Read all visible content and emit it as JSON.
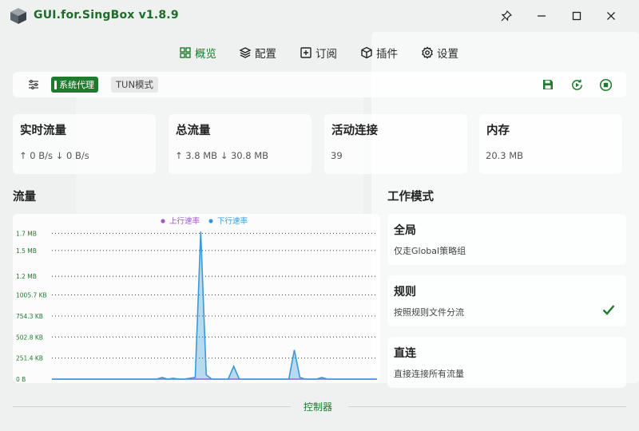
{
  "app": {
    "title": "GUI.for.SingBox v1.8.9"
  },
  "nav": {
    "tabs": [
      {
        "label": "概览",
        "icon": "grid-icon",
        "active": true
      },
      {
        "label": "配置",
        "icon": "layers-icon",
        "active": false
      },
      {
        "label": "订阅",
        "icon": "add-box-icon",
        "active": false
      },
      {
        "label": "插件",
        "icon": "package-icon",
        "active": false
      },
      {
        "label": "设置",
        "icon": "settings-icon",
        "active": false
      }
    ]
  },
  "toolbar": {
    "system_proxy_label": "系统代理",
    "tun_label": "TUN模式",
    "icons": [
      "sliders-icon",
      "save-icon",
      "restart-icon",
      "stop-icon"
    ]
  },
  "stats": [
    {
      "title": "实时流量",
      "value": "↑ 0 B/s ↓ 0 B/s"
    },
    {
      "title": "总流量",
      "value": "↑ 3.8 MB ↓ 30.8 MB"
    },
    {
      "title": "活动连接",
      "value": "39"
    },
    {
      "title": "内存",
      "value": "20.3 MB"
    }
  ],
  "traffic": {
    "section_title": "流量"
  },
  "chart_data": {
    "type": "line",
    "y_ticks": [
      "0 B",
      "251.4 KB",
      "502.8 KB",
      "754.3 KB",
      "1005.7 KB",
      "1.2 MB",
      "1.5 MB",
      "1.7 MB"
    ],
    "ylim": [
      0,
      1.75
    ],
    "yunit": "MB",
    "legend_position": "top",
    "series": [
      {
        "name": "上行速率",
        "color": "#9b59d0",
        "values": [
          0,
          0,
          0,
          0,
          0,
          0,
          0,
          0,
          0,
          0,
          0,
          0,
          0,
          0,
          0,
          0,
          0,
          0,
          0,
          0,
          0,
          0,
          0,
          0,
          0,
          0,
          0,
          0,
          0,
          0,
          0,
          0,
          0,
          0,
          0,
          0,
          0,
          0,
          0,
          0,
          0,
          0,
          0,
          0,
          0,
          0,
          0,
          0,
          0,
          0,
          0,
          0,
          0,
          0,
          0,
          0,
          0,
          0,
          0,
          0
        ]
      },
      {
        "name": "下行速率",
        "color": "#3a9ad9",
        "values": [
          0,
          0,
          0,
          0,
          0,
          0,
          0,
          0,
          0,
          0,
          0,
          0,
          0,
          0,
          0,
          0,
          0,
          0,
          0,
          0,
          0.02,
          0,
          0.01,
          0,
          0,
          0.01,
          0.02,
          1.72,
          0.05,
          0,
          0,
          0,
          0,
          0.15,
          0,
          0,
          0,
          0,
          0,
          0,
          0,
          0,
          0,
          0,
          0.34,
          0.02,
          0,
          0,
          0,
          0.02,
          0,
          0,
          0,
          0,
          0,
          0,
          0,
          0,
          0,
          0
        ]
      }
    ]
  },
  "mode": {
    "section_title": "工作模式",
    "items": [
      {
        "title": "全局",
        "desc": "仅走Global策略组",
        "selected": false
      },
      {
        "title": "规则",
        "desc": "按照规则文件分流",
        "selected": true
      },
      {
        "title": "直连",
        "desc": "直接连接所有流量",
        "selected": false
      }
    ]
  },
  "footer": {
    "label": "控制器"
  },
  "colors": {
    "accent": "#1e7b2e",
    "download": "#3a9ad9",
    "upload": "#9b59d0"
  }
}
